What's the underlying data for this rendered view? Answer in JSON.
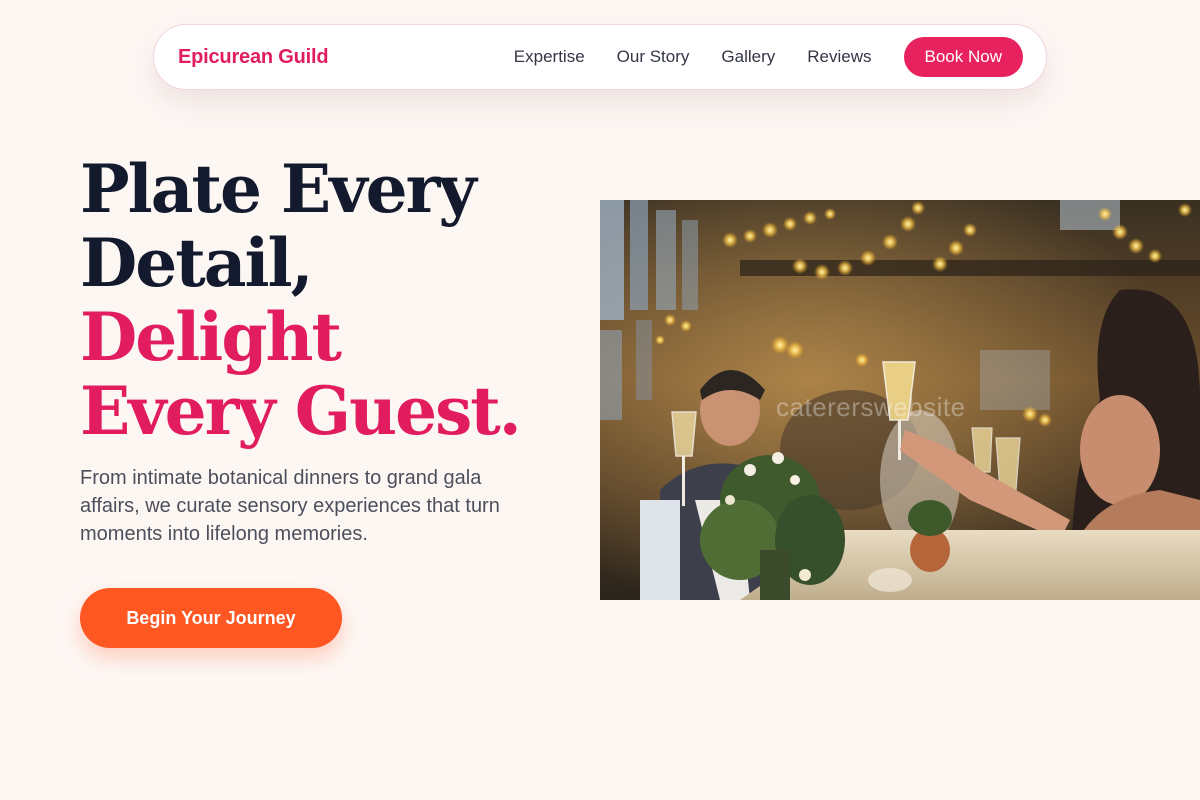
{
  "nav": {
    "brand": "Epicurean Guild",
    "links": [
      "Expertise",
      "Our Story",
      "Gallery",
      "Reviews"
    ],
    "cta": "Book Now"
  },
  "hero": {
    "title_dark": [
      "Plate Every",
      "Detail,"
    ],
    "title_accent": [
      "Delight",
      "Every Guest."
    ],
    "subtitle": "From intimate botanical dinners to grand gala affairs, we curate sensory experiences that turn moments into lifelong memories.",
    "cta": "Begin Your Journey",
    "image_watermark": "catererswebsite"
  },
  "colors": {
    "accent": "#e11d5f",
    "cta": "#ff5722",
    "background": "#fdf7f4",
    "heading": "#141a2e"
  }
}
